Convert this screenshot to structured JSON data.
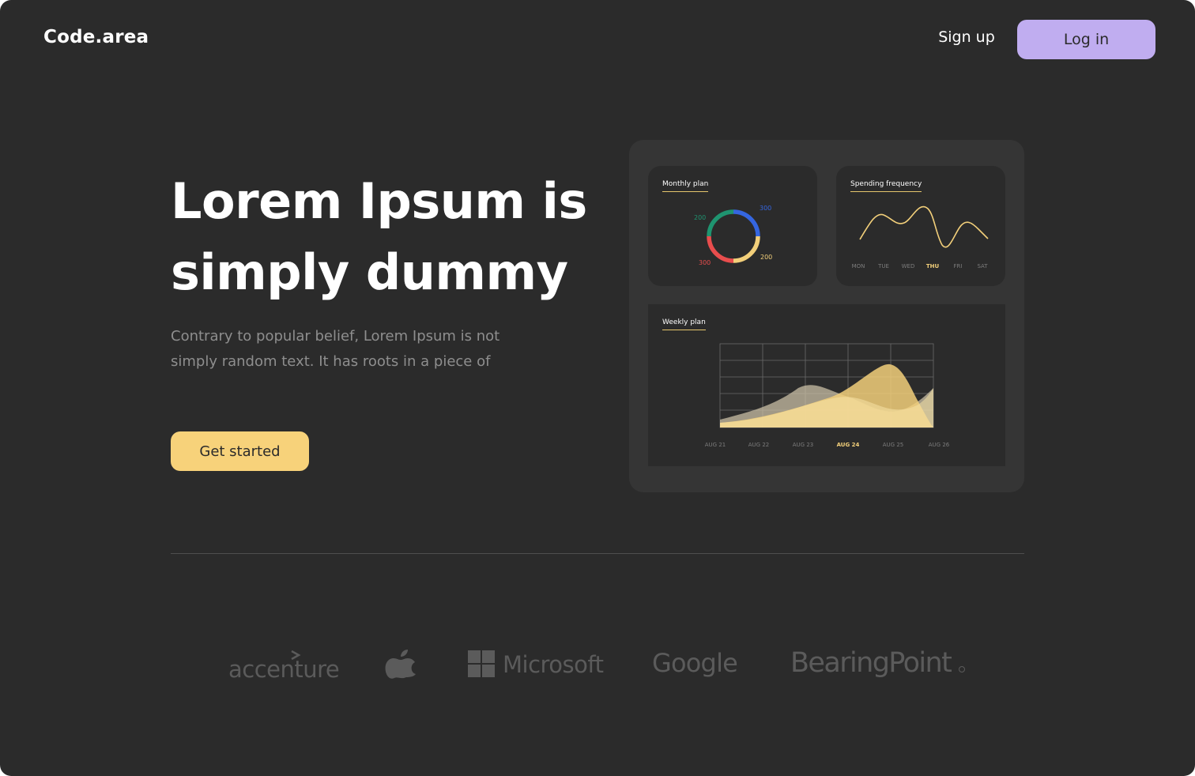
{
  "header": {
    "logo": "Code.area",
    "signup_label": "Sign up",
    "login_label": "Log in"
  },
  "hero": {
    "headline_line1": "Lorem Ipsum is",
    "headline_line2": "simply dummy",
    "subtext_line1": "Contrary to popular belief, Lorem Ipsum is not",
    "subtext_line2": "simply random text. It has roots in a piece of",
    "cta_label": "Get started"
  },
  "dashboard": {
    "monthly_plan": {
      "title": "Monthly plan",
      "labels": {
        "top_right": "300",
        "top_left": "200",
        "bottom_left": "300",
        "bottom_right": "200"
      }
    },
    "spending_frequency": {
      "title": "Spending frequency",
      "days": [
        "MON",
        "TUE",
        "WED",
        "THU",
        "FRI",
        "SAT"
      ],
      "active_day": "THU"
    },
    "weekly_plan": {
      "title": "Weekly plan",
      "dates": [
        "AUG 21",
        "AUG 22",
        "AUG 23",
        "AUG 24",
        "AUG 25",
        "AUG 26"
      ],
      "active_date": "AUG 24"
    }
  },
  "brands": [
    "accenture",
    "Microsoft",
    "Google",
    "BearingPoint"
  ],
  "colors": {
    "background": "#2b2b2b",
    "login_button": "#c0adf0",
    "cta_button": "#f7d27a",
    "accent_yellow": "#f2cf7a"
  },
  "icons": {
    "apple": "apple-logo-icon",
    "microsoft": "microsoft-logo-icon"
  }
}
